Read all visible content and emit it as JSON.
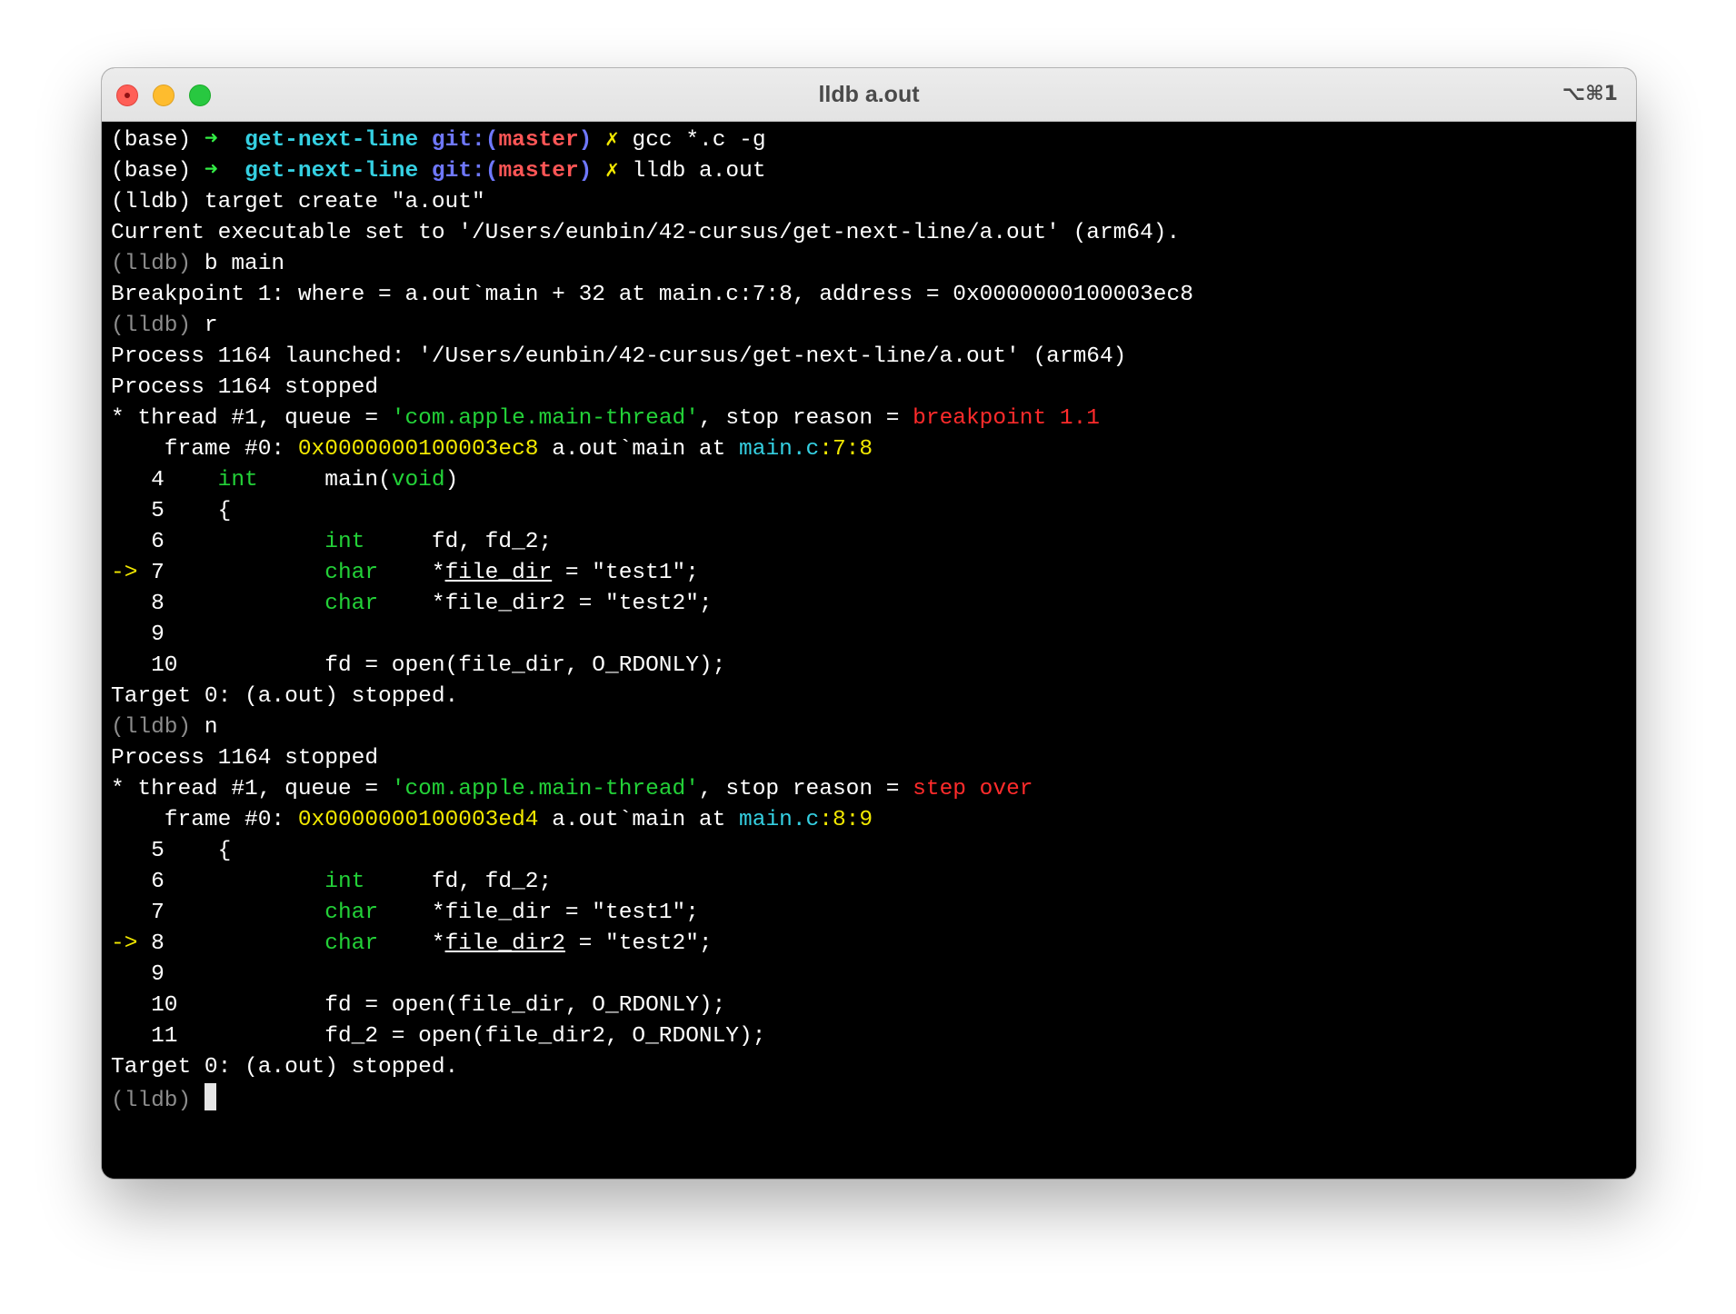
{
  "window": {
    "title": "lldb a.out",
    "shortcut": "⌥⌘1"
  },
  "colors": {
    "background": "#000000",
    "titlebar": "#e8e8e8",
    "text": "#ffffff",
    "prompt_grey": "#8c8c8c",
    "green": "#23d138",
    "cyan": "#35d0e2",
    "blue": "#6f78ff",
    "red": "#ff2b2b",
    "yellow": "#f2e800"
  },
  "terminal": {
    "lines": [
      {
        "segs": [
          {
            "t": "(base) ",
            "c": "white"
          },
          {
            "t": "➜  ",
            "c": "bgreen"
          },
          {
            "t": "get-next-line ",
            "c": "cyan"
          },
          {
            "t": "git:(",
            "c": "blue"
          },
          {
            "t": "master",
            "c": "red"
          },
          {
            "t": ")",
            "c": "blue"
          },
          {
            "t": " ✗ ",
            "c": "yb"
          },
          {
            "t": "gcc *.c -g",
            "c": "white"
          }
        ]
      },
      {
        "segs": [
          {
            "t": "(base) ",
            "c": "white"
          },
          {
            "t": "➜  ",
            "c": "bgreen"
          },
          {
            "t": "get-next-line ",
            "c": "cyan"
          },
          {
            "t": "git:(",
            "c": "blue"
          },
          {
            "t": "master",
            "c": "red"
          },
          {
            "t": ")",
            "c": "blue"
          },
          {
            "t": " ✗ ",
            "c": "yb"
          },
          {
            "t": "lldb a.out",
            "c": "white"
          }
        ]
      },
      {
        "segs": [
          {
            "t": "(lldb) target create \"a.out\"",
            "c": "white"
          }
        ]
      },
      {
        "segs": [
          {
            "t": "Current executable set to '/Users/eunbin/42-cursus/get-next-line/a.out' (arm64).",
            "c": "white"
          }
        ]
      },
      {
        "segs": [
          {
            "t": "(lldb) ",
            "c": "grey"
          },
          {
            "t": "b main",
            "c": "white"
          }
        ]
      },
      {
        "segs": [
          {
            "t": "Breakpoint 1: where = a.out`main + 32 at main.c:7:8, address = 0x0000000100003ec8",
            "c": "white"
          }
        ]
      },
      {
        "segs": [
          {
            "t": "(lldb) ",
            "c": "grey"
          },
          {
            "t": "r",
            "c": "white"
          }
        ]
      },
      {
        "segs": [
          {
            "t": "Process 1164 launched: '/Users/eunbin/42-cursus/get-next-line/a.out' (arm64)",
            "c": "white"
          }
        ]
      },
      {
        "segs": [
          {
            "t": "Process 1164 stopped",
            "c": "white"
          }
        ]
      },
      {
        "segs": [
          {
            "t": "* thread #1, queue = ",
            "c": "white"
          },
          {
            "t": "'com.apple.main-thread'",
            "c": "green"
          },
          {
            "t": ", stop reason = ",
            "c": "white"
          },
          {
            "t": "breakpoint 1.1",
            "c": "red-n"
          }
        ]
      },
      {
        "segs": [
          {
            "t": "    frame #0: ",
            "c": "white"
          },
          {
            "t": "0x0000000100003ec8",
            "c": "yellow"
          },
          {
            "t": " a.out`main at ",
            "c": "white"
          },
          {
            "t": "main.c",
            "c": "cyan-n"
          },
          {
            "t": ":7:8",
            "c": "yellow"
          }
        ]
      },
      {
        "segs": [
          {
            "t": "   4    ",
            "c": "white"
          },
          {
            "t": "int",
            "c": "green"
          },
          {
            "t": "     main(",
            "c": "white"
          },
          {
            "t": "void",
            "c": "green"
          },
          {
            "t": ")",
            "c": "white"
          }
        ]
      },
      {
        "segs": [
          {
            "t": "   5    {",
            "c": "white"
          }
        ]
      },
      {
        "segs": [
          {
            "t": "   6            ",
            "c": "white"
          },
          {
            "t": "int",
            "c": "green"
          },
          {
            "t": "     fd, fd_2;",
            "c": "white"
          }
        ]
      },
      {
        "segs": [
          {
            "t": "-> ",
            "c": "yellow"
          },
          {
            "t": "7            ",
            "c": "white"
          },
          {
            "t": "char",
            "c": "green"
          },
          {
            "t": "    *",
            "c": "white"
          },
          {
            "t": "file_dir",
            "c": "white",
            "u": true
          },
          {
            "t": " = \"test1\";",
            "c": "white"
          }
        ]
      },
      {
        "segs": [
          {
            "t": "   8            ",
            "c": "white"
          },
          {
            "t": "char",
            "c": "green"
          },
          {
            "t": "    *file_dir2 = \"test2\";",
            "c": "white"
          }
        ]
      },
      {
        "segs": [
          {
            "t": "   9",
            "c": "white"
          }
        ]
      },
      {
        "segs": [
          {
            "t": "   10           fd = open(file_dir, O_RDONLY);",
            "c": "white"
          }
        ]
      },
      {
        "segs": [
          {
            "t": "Target 0: (a.out) stopped.",
            "c": "white"
          }
        ]
      },
      {
        "segs": [
          {
            "t": "(lldb) ",
            "c": "grey"
          },
          {
            "t": "n",
            "c": "white"
          }
        ]
      },
      {
        "segs": [
          {
            "t": "Process 1164 stopped",
            "c": "white"
          }
        ]
      },
      {
        "segs": [
          {
            "t": "* thread #1, queue = ",
            "c": "white"
          },
          {
            "t": "'com.apple.main-thread'",
            "c": "green"
          },
          {
            "t": ", stop reason = ",
            "c": "white"
          },
          {
            "t": "step over",
            "c": "red-n"
          }
        ]
      },
      {
        "segs": [
          {
            "t": "    frame #0: ",
            "c": "white"
          },
          {
            "t": "0x0000000100003ed4",
            "c": "yellow"
          },
          {
            "t": " a.out`main at ",
            "c": "white"
          },
          {
            "t": "main.c",
            "c": "cyan-n"
          },
          {
            "t": ":8:9",
            "c": "yellow"
          }
        ]
      },
      {
        "segs": [
          {
            "t": "   5    {",
            "c": "white"
          }
        ]
      },
      {
        "segs": [
          {
            "t": "   6            ",
            "c": "white"
          },
          {
            "t": "int",
            "c": "green"
          },
          {
            "t": "     fd, fd_2;",
            "c": "white"
          }
        ]
      },
      {
        "segs": [
          {
            "t": "   7            ",
            "c": "white"
          },
          {
            "t": "char",
            "c": "green"
          },
          {
            "t": "    *file_dir = \"test1\";",
            "c": "white"
          }
        ]
      },
      {
        "segs": [
          {
            "t": "-> ",
            "c": "yellow"
          },
          {
            "t": "8            ",
            "c": "white"
          },
          {
            "t": "char",
            "c": "green"
          },
          {
            "t": "    *",
            "c": "white"
          },
          {
            "t": "file_dir2",
            "c": "white",
            "u": true
          },
          {
            "t": " = \"test2\";",
            "c": "white"
          }
        ]
      },
      {
        "segs": [
          {
            "t": "   9",
            "c": "white"
          }
        ]
      },
      {
        "segs": [
          {
            "t": "   10           fd = open(file_dir, O_RDONLY);",
            "c": "white"
          }
        ]
      },
      {
        "segs": [
          {
            "t": "   11           fd_2 = open(file_dir2, O_RDONLY);",
            "c": "white"
          }
        ]
      },
      {
        "segs": [
          {
            "t": "Target 0: (a.out) stopped.",
            "c": "white"
          }
        ]
      },
      {
        "segs": [
          {
            "t": "(lldb) ",
            "c": "grey"
          }
        ],
        "cursor": true
      }
    ]
  }
}
